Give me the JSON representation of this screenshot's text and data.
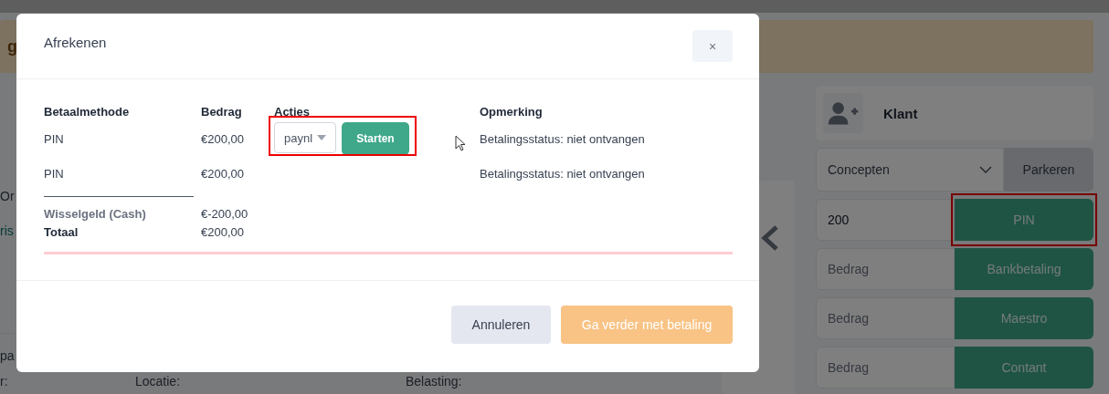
{
  "background": {
    "banner_fragment": "g",
    "left_fragments": [
      {
        "text": "Or",
        "kind": "text"
      },
      {
        "text": "ris",
        "kind": "link"
      },
      {
        "text": "pa",
        "kind": "text"
      }
    ],
    "field_labels": [
      "r:",
      "Locatie:",
      "Belasting:"
    ]
  },
  "sidebar": {
    "customer_label": "Klant",
    "concepts_select": "Concepten",
    "park_button": "Parkeren",
    "payments": [
      {
        "value": "200",
        "method": "PIN",
        "highlighted": true
      },
      {
        "placeholder": "Bedrag",
        "method": "Bankbetaling",
        "highlighted": false
      },
      {
        "placeholder": "Bedrag",
        "method": "Maestro",
        "highlighted": false
      },
      {
        "placeholder": "Bedrag",
        "method": "Contant",
        "highlighted": false
      }
    ]
  },
  "modal": {
    "title": "Afrekenen",
    "close": "×",
    "columns": [
      "Betaalmethode",
      "Bedrag",
      "Acties",
      "Opmerking"
    ],
    "rows": [
      {
        "method": "PIN",
        "amount": "€200,00",
        "provider": "paynl",
        "action": "Starten",
        "highlighted": true,
        "note": "Betalingsstatus: niet ontvangen"
      },
      {
        "method": "PIN",
        "amount": "€200,00",
        "highlighted": false,
        "note": "Betalingsstatus: niet ontvangen"
      }
    ],
    "summary": [
      {
        "label": "Wisselgeld (Cash)",
        "amount": "€-200,00",
        "muted": true
      },
      {
        "label": "Totaal",
        "amount": "€200,00",
        "muted": false
      }
    ],
    "cancel_button": "Annuleren",
    "confirm_button": "Ga verder met betaling"
  }
}
